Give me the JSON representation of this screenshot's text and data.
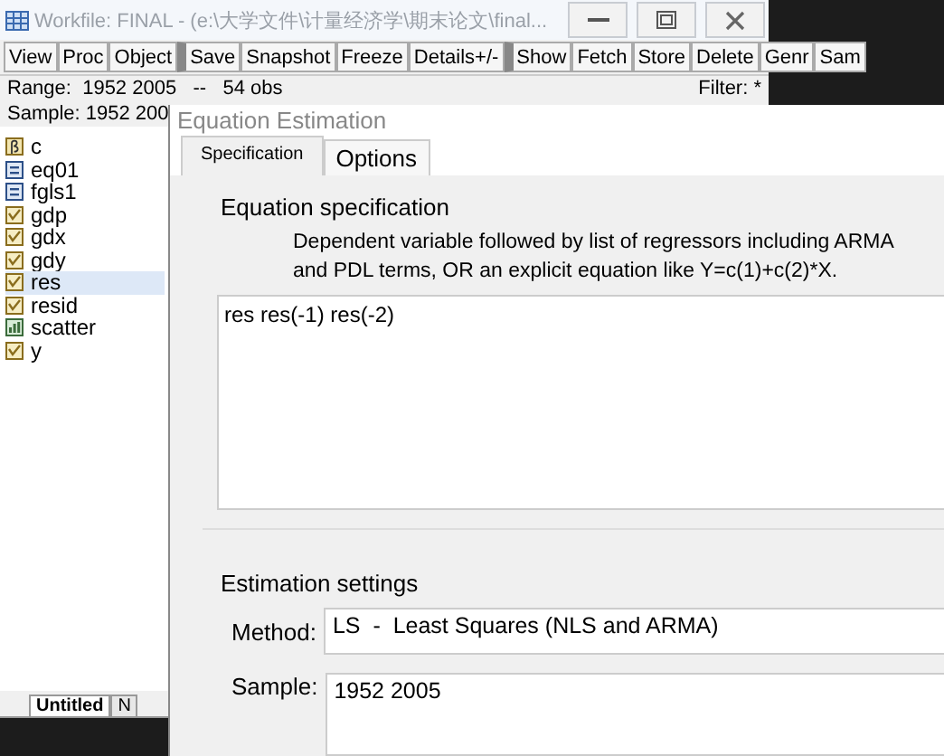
{
  "workfile": {
    "title": "Workfile: FINAL - (e:\\大学文件\\计量经济学\\期末论文\\final...",
    "toolbar": [
      {
        "label": "View",
        "group_start": false
      },
      {
        "label": "Proc",
        "group_start": false
      },
      {
        "label": "Object",
        "group_start": false
      },
      {
        "label": "Save",
        "group_start": true
      },
      {
        "label": "Snapshot",
        "group_start": false
      },
      {
        "label": "Freeze",
        "group_start": false
      },
      {
        "label": "Details+/-",
        "group_start": false
      },
      {
        "label": "Show",
        "group_start": true
      },
      {
        "label": "Fetch",
        "group_start": false
      },
      {
        "label": "Store",
        "group_start": false
      },
      {
        "label": "Delete",
        "group_start": false
      },
      {
        "label": "Genr",
        "group_start": false
      },
      {
        "label": "Sam",
        "group_start": false
      }
    ],
    "range": "Range:  1952 2005   --   54 obs",
    "filter": "Filter: *",
    "sample": "Sample: 1952 200",
    "objects": [
      {
        "name": "c",
        "kind": "coef",
        "selected": false
      },
      {
        "name": "eq01",
        "kind": "equation",
        "selected": false
      },
      {
        "name": "fgls1",
        "kind": "equation",
        "selected": false
      },
      {
        "name": "gdp",
        "kind": "series",
        "selected": false
      },
      {
        "name": "gdx",
        "kind": "series",
        "selected": false
      },
      {
        "name": "gdy",
        "kind": "series",
        "selected": false
      },
      {
        "name": "res",
        "kind": "series",
        "selected": true
      },
      {
        "name": "resid",
        "kind": "series",
        "selected": false
      },
      {
        "name": "scatter",
        "kind": "graph",
        "selected": false
      },
      {
        "name": "y",
        "kind": "series",
        "selected": false
      }
    ],
    "page_tabs": [
      {
        "label": "Untitled",
        "selected": true
      },
      {
        "label": "N",
        "selected": false
      }
    ]
  },
  "dialog": {
    "title": "Equation Estimation",
    "tabs": [
      {
        "label": "Specification",
        "selected": true
      },
      {
        "label": "Options",
        "selected": false
      }
    ],
    "spec_group": "Equation specification",
    "spec_help": "Dependent variable followed by list of regressors including ARMA\nand PDL terms, OR an explicit equation like Y=c(1)+c(2)*X.",
    "spec_value": "res res(-1) res(-2)",
    "settings_group": "Estimation settings",
    "method": {
      "label": "Method:",
      "value": "LS  -  Least Squares (NLS and ARMA)"
    },
    "sample": {
      "label": "Sample:",
      "value": "1952 2005"
    }
  }
}
